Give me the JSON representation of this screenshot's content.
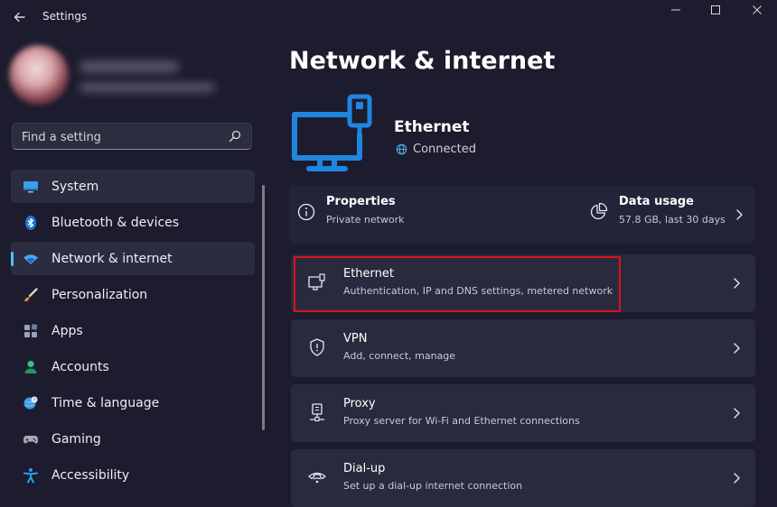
{
  "window": {
    "title": "Settings"
  },
  "sidebar": {
    "search": {
      "placeholder": "Find a setting"
    },
    "items": [
      {
        "label": "System"
      },
      {
        "label": "Bluetooth & devices"
      },
      {
        "label": "Network & internet"
      },
      {
        "label": "Personalization"
      },
      {
        "label": "Apps"
      },
      {
        "label": "Accounts"
      },
      {
        "label": "Time & language"
      },
      {
        "label": "Gaming"
      },
      {
        "label": "Accessibility"
      }
    ],
    "selected_index": 2
  },
  "main": {
    "title": "Network & internet",
    "hero": {
      "name": "Ethernet",
      "status": "Connected"
    },
    "properties": {
      "title": "Properties",
      "subtitle": "Private network"
    },
    "data_usage": {
      "title": "Data usage",
      "subtitle": "57.8 GB, last 30 days"
    },
    "cards": [
      {
        "title": "Ethernet",
        "subtitle": "Authentication, IP and DNS settings, metered network"
      },
      {
        "title": "VPN",
        "subtitle": "Add, connect, manage"
      },
      {
        "title": "Proxy",
        "subtitle": "Proxy server for Wi-Fi and Ethernet connections"
      },
      {
        "title": "Dial-up",
        "subtitle": "Set up a dial-up internet connection"
      }
    ]
  },
  "colors": {
    "background": "#1c1c2e",
    "accent": "#4cc2ff",
    "ethernet_icon": "#1f86e0",
    "highlight_box": "#d4141c"
  }
}
